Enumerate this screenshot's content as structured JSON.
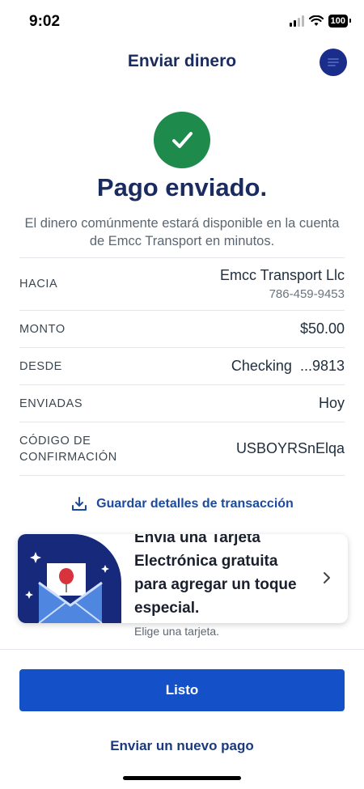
{
  "status_bar": {
    "time": "9:02",
    "battery": "100"
  },
  "header": {
    "title": "Enviar dinero"
  },
  "success": {
    "title": "Pago enviado.",
    "subtitle": "El dinero comúnmente estará disponible en la cuenta de Emcc Transport en minutos."
  },
  "details": {
    "to_label": "HACIA",
    "to_name": "Emcc Transport Llc",
    "to_phone": "786-459-9453",
    "amount_label": "MONTO",
    "amount_value": "$50.00",
    "from_label": "DESDE",
    "from_value": "Checking  ...9813",
    "sent_label": "ENVIADAS",
    "sent_value": "Hoy",
    "confirmation_label": "CÓDIGO DE CONFIRMACIÓN",
    "confirmation_value": "USBOYRSnElqa"
  },
  "save_link": {
    "label": "Guardar detalles de transacción"
  },
  "promo": {
    "text": "Envía una Tarjeta Electrónica gratuita para agregar un toque especial.",
    "caption": "Elige una tarjeta."
  },
  "actions": {
    "done_label": "Listo",
    "new_payment_label": "Enviar un nuevo pago"
  },
  "colors": {
    "brand_navy": "#1a2b5f",
    "primary_button": "#1450c8",
    "success_green": "#1e8a4c"
  }
}
